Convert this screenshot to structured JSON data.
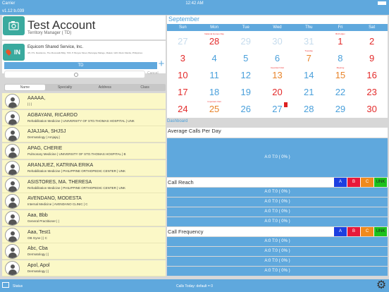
{
  "status_bar": {
    "carrier": "Carrier",
    "time": "12:42 AM"
  },
  "version": "v1.12 b.039",
  "account": {
    "name": "Test Account",
    "role": "Territory Manager ( TD)",
    "checkin_label": "IN",
    "company": "Equicom Shared Service, Inc.",
    "address": "3/F, P.S. Residence, The Moonwalk Bldg. 70th. P. Burgos Street, Barangay Maloge, Makati, 1221 Metro Manila, Philippines"
  },
  "list": {
    "header": "TD",
    "add_label": "+",
    "cancel_label": "Cancel",
    "tabs": [
      "Name",
      "Specialty",
      "Address",
      "Class"
    ],
    "selected_tab": "Name",
    "doctors": [
      {
        "name": "AAAAA,",
        "sub": "| | |"
      },
      {
        "name": "AGBAYANI, RICARDO",
        "sub": "Rehabilitation Medicine | UNIVERSITY OF STO.THOMAS HOSPITAL | UNK"
      },
      {
        "name": "AJAJJAA, SHJSJ",
        "sub": "Dermatology | Amjajaj |"
      },
      {
        "name": "APAG, CHERIE",
        "sub": "Pulmonary Medicine | UNIVERSITY OF STO.THOMAS HOSPITAL | B"
      },
      {
        "name": "ARANJUEZ, KATRINA ERIKA",
        "sub": "Rehabilitation Medicine | PHILIPPINE ORTHOPEDIC CENTER | UNK"
      },
      {
        "name": "ASISTORES, MA. THERESA",
        "sub": "Rehabilitation Medicine | PHILIPPINE ORTHOPEDIC CENTER | UNK"
      },
      {
        "name": "AVENDANO, MODESTA",
        "sub": "Internal Medicine | AVENDANO CLINIC | C"
      },
      {
        "name": "Aaa, Bbb",
        "sub": "General Practitioner | |"
      },
      {
        "name": "Aaa, Test1",
        "sub": "OB Gyne | | C"
      },
      {
        "name": "Abc, Cba",
        "sub": "Dermatology | |"
      },
      {
        "name": "Apol, Apol",
        "sub": "Dermatology | |"
      }
    ]
  },
  "calendar": {
    "month": "September",
    "weekdays": [
      "Sun",
      "Mon",
      "Tue",
      "Wed",
      "Thu",
      "Fri",
      "Sat"
    ],
    "days": [
      {
        "n": "27",
        "c": "gray",
        "lab": ""
      },
      {
        "n": "28",
        "c": "red",
        "lab": "National Heroes Day"
      },
      {
        "n": "29",
        "c": "gray",
        "lab": ""
      },
      {
        "n": "30",
        "c": "gray",
        "lab": ""
      },
      {
        "n": "31",
        "c": "gray",
        "lab": ""
      },
      {
        "n": "1",
        "c": "red",
        "lab": "Birth Ajlex"
      },
      {
        "n": "2",
        "c": "red",
        "lab": ""
      },
      {
        "n": "3",
        "c": "red",
        "lab": ""
      },
      {
        "n": "4",
        "c": "blue",
        "lab": ""
      },
      {
        "n": "5",
        "c": "blue",
        "lab": ""
      },
      {
        "n": "6",
        "c": "blue",
        "lab": ""
      },
      {
        "n": "7",
        "c": "orange",
        "lab": "Tuesday"
      },
      {
        "n": "8",
        "c": "blue",
        "lab": ""
      },
      {
        "n": "9",
        "c": "red",
        "lab": ""
      },
      {
        "n": "10",
        "c": "red",
        "lab": ""
      },
      {
        "n": "11",
        "c": "blue",
        "lab": ""
      },
      {
        "n": "12",
        "c": "blue",
        "lab": ""
      },
      {
        "n": "13",
        "c": "orange",
        "lab": "Important Visit"
      },
      {
        "n": "14",
        "c": "blue",
        "lab": ""
      },
      {
        "n": "15",
        "c": "orange",
        "lab": "Meeting"
      },
      {
        "n": "16",
        "c": "red",
        "lab": ""
      },
      {
        "n": "17",
        "c": "red",
        "lab": ""
      },
      {
        "n": "18",
        "c": "blue",
        "lab": ""
      },
      {
        "n": "19",
        "c": "blue",
        "lab": ""
      },
      {
        "n": "20",
        "c": "red",
        "lab": ""
      },
      {
        "n": "21",
        "c": "blue",
        "lab": ""
      },
      {
        "n": "22",
        "c": "blue",
        "lab": ""
      },
      {
        "n": "23",
        "c": "red",
        "lab": ""
      },
      {
        "n": "24",
        "c": "red",
        "lab": ""
      },
      {
        "n": "25",
        "c": "orange",
        "lab": "Important Visit"
      },
      {
        "n": "26",
        "c": "blue",
        "lab": ""
      },
      {
        "n": "27",
        "c": "blue",
        "lab": "",
        "flag": true
      },
      {
        "n": "28",
        "c": "blue",
        "lab": ""
      },
      {
        "n": "29",
        "c": "blue",
        "lab": ""
      },
      {
        "n": "30",
        "c": "red",
        "lab": ""
      }
    ]
  },
  "dashboard": {
    "label": "Dashboard",
    "avg_calls": {
      "title": "Average Calls Per Day",
      "value": "A:0 T:0 ( 0% )"
    },
    "call_reach": {
      "title": "Call Reach",
      "rows": [
        "A:0 T:0 ( 0% )",
        "A:0 T:0 ( 0% )",
        "A:0 T:0 ( 0% )",
        "A:0 T:0 ( 0% )",
        "A:0 T:0 ( 0% )"
      ]
    },
    "call_frequency": {
      "title": "Call Frequency",
      "rows": [
        "A:0 T:0 ( 0% )",
        "A:0 T:0 ( 0% )",
        "A:0 T:0 ( 0% )",
        "A:0 T:0 ( 0% )"
      ]
    },
    "class_buttons": [
      "A",
      "B",
      "C",
      "UNK"
    ]
  },
  "bottom": {
    "status": "Status",
    "calls_today": "Calls Today: default = 0"
  }
}
